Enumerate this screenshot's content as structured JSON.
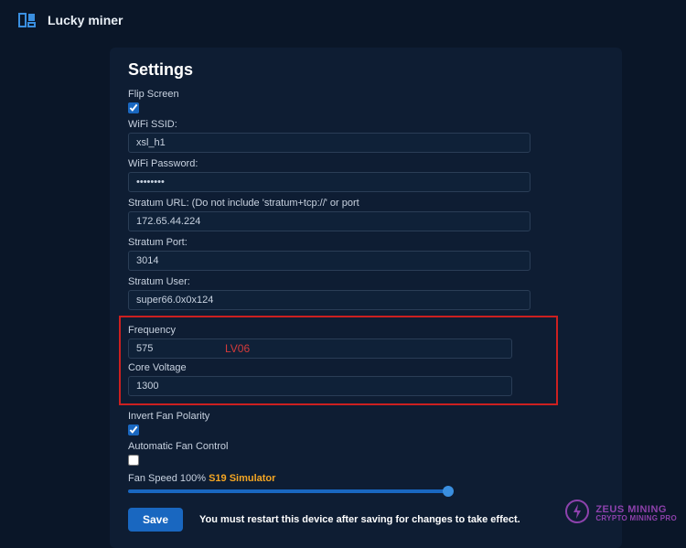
{
  "header": {
    "brand": "Lucky miner"
  },
  "settings": {
    "title": "Settings",
    "flip_screen_label": "Flip Screen",
    "flip_screen_checked": true,
    "wifi_ssid_label": "WiFi SSID:",
    "wifi_ssid_value": "xsl_h1",
    "wifi_password_label": "WiFi Password:",
    "wifi_password_value": "••••••••",
    "stratum_url_label": "Stratum URL: (Do not include 'stratum+tcp://' or port",
    "stratum_url_value": "172.65.44.224",
    "stratum_port_label": "Stratum Port:",
    "stratum_port_value": "3014",
    "stratum_user_label": "Stratum User:",
    "stratum_user_value": "super66.0x0x124",
    "frequency_label": "Frequency",
    "frequency_value": "575",
    "core_voltage_label": "Core Voltage",
    "core_voltage_value": "1300",
    "highlight_annotation": "LV06",
    "invert_fan_label": "Invert Fan Polarity",
    "invert_fan_checked": true,
    "auto_fan_label": "Automatic Fan Control",
    "auto_fan_checked": false,
    "fan_speed_label": "Fan Speed 100% ",
    "fan_speed_simulator": "S19 Simulator",
    "save_label": "Save",
    "restart_msg": "You must restart this device after saving for changes to take effect."
  },
  "watermark": {
    "line1": "ZEUS MINING",
    "line2": "CRYPTO MINING PRO"
  }
}
